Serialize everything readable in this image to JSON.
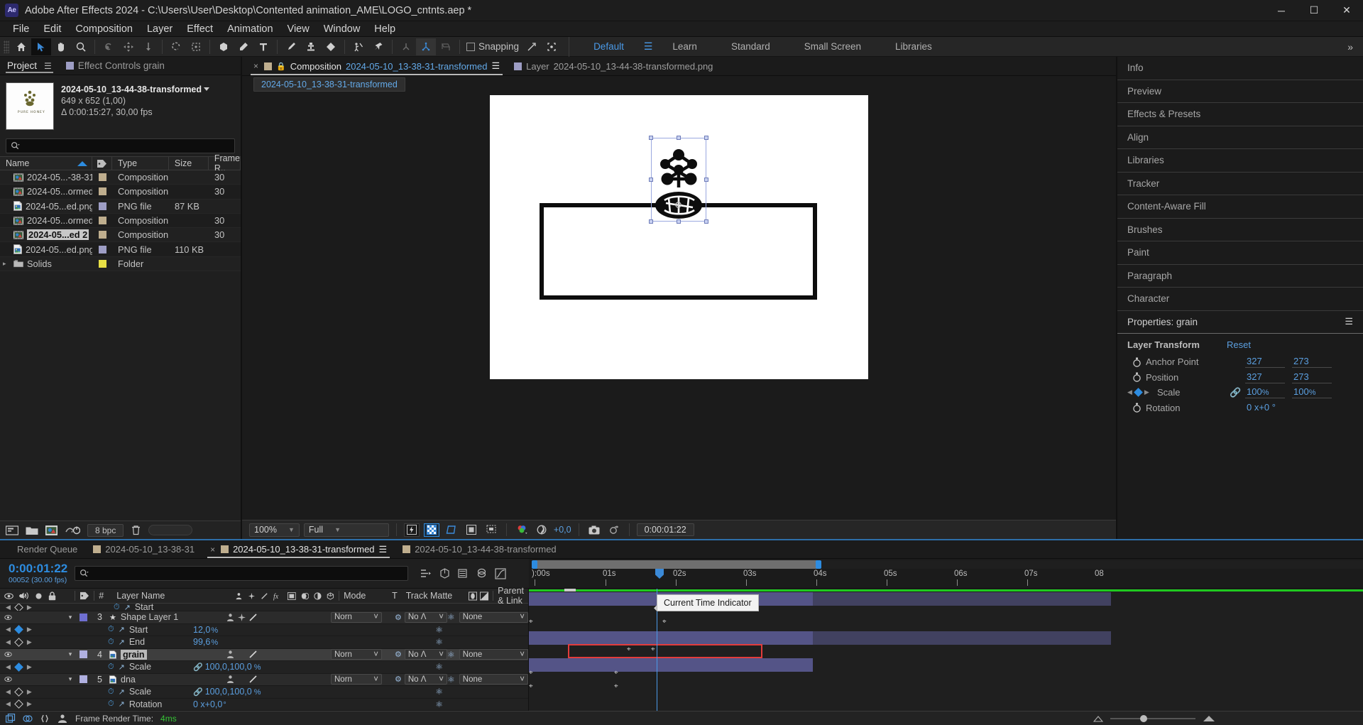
{
  "window": {
    "title": "Adobe After Effects 2024 - C:\\Users\\User\\Desktop\\Contented animation_AME\\LOGO_cntnts.aep *",
    "logo": "Ae",
    "minimize": "─",
    "maximize": "☐",
    "close": "✕"
  },
  "menubar": [
    "File",
    "Edit",
    "Composition",
    "Layer",
    "Effect",
    "Animation",
    "View",
    "Window",
    "Help"
  ],
  "toolbar": {
    "snapping_label": "Snapping",
    "workspaces": [
      "Default",
      "Learn",
      "Standard",
      "Small Screen",
      "Libraries"
    ],
    "active_workspace": "Default",
    "overflow": "»"
  },
  "project_panel": {
    "tabs": [
      {
        "label": "Project",
        "active": true
      },
      {
        "label": "Effect Controls grain",
        "active": false
      }
    ],
    "selected_asset": {
      "name": "2024-05-10_13-44-38-transformed",
      "dimensions": "649 x 652 (1,00)",
      "duration": "Δ 0:00:15:27,  30,00 fps"
    },
    "search_placeholder": "",
    "columns": [
      "Name",
      "Type",
      "Size",
      "Frame R.."
    ],
    "items": [
      {
        "name": "2024-05...-38-31",
        "icon": "composition-icon",
        "swatch": "tan",
        "type": "Composition",
        "size": "",
        "framerate": "30",
        "selected": false
      },
      {
        "name": "2024-05...ormed",
        "icon": "composition-icon",
        "swatch": "tan",
        "type": "Composition",
        "size": "",
        "framerate": "30",
        "selected": false
      },
      {
        "name": "2024-05...ed.png",
        "icon": "png-icon",
        "swatch": "lav",
        "type": "PNG file",
        "size": "87 KB",
        "framerate": "",
        "selected": false
      },
      {
        "name": "2024-05...ormed",
        "icon": "composition-icon",
        "swatch": "tan",
        "type": "Composition",
        "size": "",
        "framerate": "30",
        "selected": false
      },
      {
        "name": "2024-05...ed 2",
        "icon": "composition-icon",
        "swatch": "tan",
        "type": "Composition",
        "size": "",
        "framerate": "30",
        "selected": true
      },
      {
        "name": "2024-05...ed.png",
        "icon": "png-icon",
        "swatch": "lav",
        "type": "PNG file",
        "size": "110 KB",
        "framerate": "",
        "selected": false
      },
      {
        "name": "Solids",
        "icon": "folder-icon",
        "swatch": "yel",
        "type": "Folder",
        "size": "",
        "framerate": "",
        "selected": false
      }
    ],
    "footer": {
      "bit_depth": "8 bpc"
    }
  },
  "composition_panel": {
    "tabs": [
      {
        "prefix": "Composition",
        "name": "2024-05-10_13-38-31-transformed",
        "active": true
      },
      {
        "prefix": "Layer",
        "name": "2024-05-10_13-44-38-transformed.png",
        "active": false
      }
    ],
    "breadcrumb": "2024-05-10_13-38-31-transformed",
    "footer": {
      "zoom": "100%",
      "resolution": "Full",
      "exposure": "+0,0",
      "timecode": "0:00:01:22"
    }
  },
  "right_panels": [
    "Info",
    "Preview",
    "Effects & Presets",
    "Align",
    "Libraries",
    "Tracker",
    "Content-Aware Fill",
    "Brushes",
    "Paint",
    "Paragraph",
    "Character"
  ],
  "properties_panel": {
    "title": "Properties: grain",
    "section": "Layer Transform",
    "reset": "Reset",
    "rows": [
      {
        "label": "Anchor Point",
        "v1": "327",
        "v2": "273",
        "unit": "",
        "animated": false,
        "linked": false
      },
      {
        "label": "Position",
        "v1": "327",
        "v2": "273",
        "unit": "",
        "animated": false,
        "linked": false
      },
      {
        "label": "Scale",
        "v1": "100",
        "v2": "100",
        "unit": "%",
        "animated": true,
        "linked": true
      },
      {
        "label": "Rotation",
        "v1": "0 x+0 °",
        "v2": "",
        "unit": "",
        "animated": false,
        "linked": false
      }
    ]
  },
  "timeline": {
    "tabs": [
      {
        "label": "Render Queue",
        "active": false,
        "swatch": false
      },
      {
        "label": "2024-05-10_13-38-31",
        "active": false,
        "swatch": true
      },
      {
        "label": "2024-05-10_13-38-31-transformed",
        "active": true,
        "swatch": true
      },
      {
        "label": "2024-05-10_13-44-38-transformed",
        "active": false,
        "swatch": true
      }
    ],
    "current_time": "0:00:01:22",
    "frame_info": "00052 (30.00 fps)",
    "search_placeholder": "",
    "columns": {
      "num": "#",
      "layer_name": "Layer Name",
      "mode": "Mode",
      "t": "T",
      "track_matte": "Track Matte",
      "parent": "Parent & Link"
    },
    "ruler_labels": [
      "):00s",
      "01s",
      "02s",
      "03s",
      "04s",
      "05s",
      "06s",
      "07s",
      "08"
    ],
    "tooltip": "Current Time Indicator",
    "rows": [
      {
        "kind": "prop-cut",
        "label": "Start",
        "value": "",
        "unit": "%"
      },
      {
        "kind": "layer",
        "num": "3",
        "name": "Shape Layer 1",
        "icon": "star-icon",
        "swatch": "#6f6fd0",
        "mode": "Norn",
        "matte": "No Λ",
        "parent": "None",
        "selected": false
      },
      {
        "kind": "prop",
        "label": "Start",
        "value": "12,0",
        "unit": "%",
        "keyframe": "solid"
      },
      {
        "kind": "prop",
        "label": "End",
        "value": "99,6",
        "unit": "%",
        "keyframe": "hollow"
      },
      {
        "kind": "layer",
        "num": "4",
        "name": "grain",
        "icon": "png-icon",
        "swatch": "#b0b0e0",
        "mode": "Norn",
        "matte": "No Λ",
        "parent": "None",
        "selected": true
      },
      {
        "kind": "prop",
        "label": "Scale",
        "value": "100,0,100,0",
        "unit": "%",
        "keyframe": "solid"
      },
      {
        "kind": "layer",
        "num": "5",
        "name": "dna",
        "icon": "png-icon",
        "swatch": "#b0b0e0",
        "mode": "Norn",
        "matte": "No Λ",
        "parent": "None",
        "selected": false
      },
      {
        "kind": "prop",
        "label": "Scale",
        "value": "100,0,100,0",
        "unit": "%",
        "keyframe": "hollow"
      },
      {
        "kind": "prop",
        "label": "Rotation",
        "value": "0 x+0,0",
        "unit": "°",
        "keyframe": "hollow"
      }
    ],
    "footer": {
      "render_label": "Frame Render Time:",
      "render_value": "4ms"
    }
  },
  "colors": {
    "accent_blue": "#2d8ce0",
    "link_blue": "#5b9fe0",
    "green": "#1fc81f",
    "red_selection": "#e23c3c",
    "tan_swatch": "#bfae8e",
    "lavender_swatch": "#9d9dc4",
    "yellow_swatch": "#e8e045"
  }
}
